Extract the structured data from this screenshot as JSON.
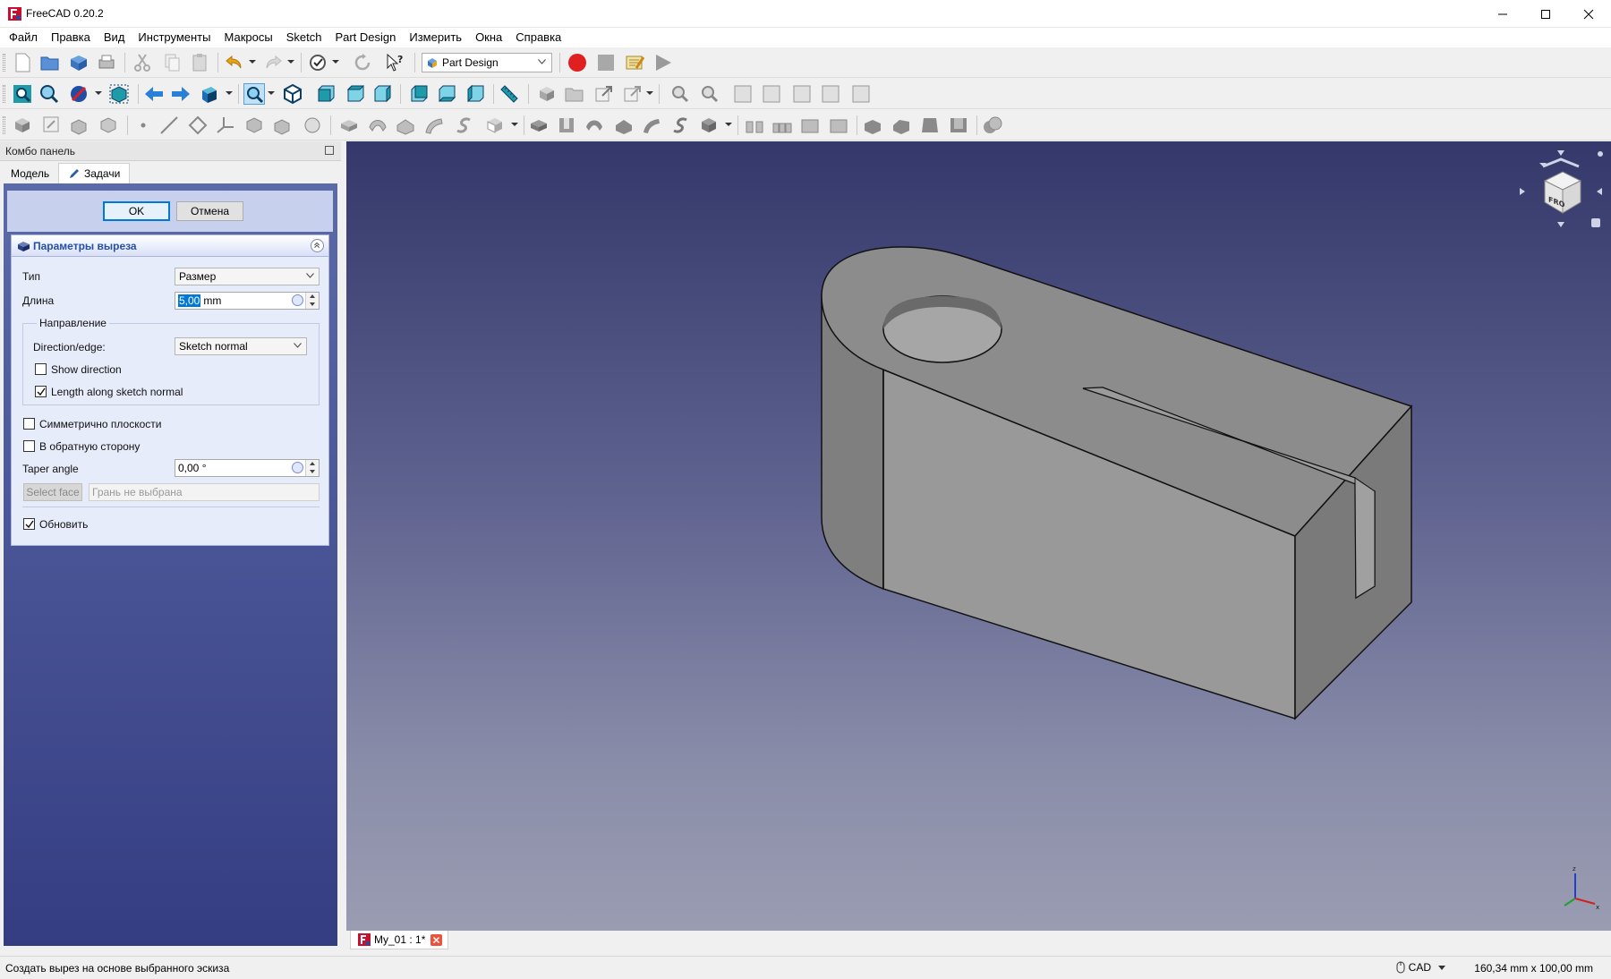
{
  "window": {
    "title": "FreeCAD 0.20.2"
  },
  "menu": [
    "Файл",
    "Правка",
    "Вид",
    "Инструменты",
    "Макросы",
    "Sketch",
    "Part Design",
    "Измерить",
    "Окна",
    "Справка"
  ],
  "toolbar": {
    "workbench": "Part Design"
  },
  "combo_panel": {
    "title": "Комбо панель",
    "tabs": {
      "model": "Модель",
      "tasks": "Задачи"
    },
    "ok_label": "OK",
    "cancel_label": "Отмена",
    "params": {
      "title": "Параметры выреза",
      "type_label": "Тип",
      "type_value": "Размер",
      "length_label": "Длина",
      "length_number": "5,00",
      "length_unit": "mm",
      "direction_group": "Направление",
      "direction_label": "Direction/edge:",
      "direction_value": "Sketch normal",
      "show_direction": "Show direction",
      "show_direction_checked": false,
      "length_along_normal": "Length along sketch normal",
      "length_along_normal_checked": true,
      "symmetric": "Симметрично плоскости",
      "symmetric_checked": false,
      "reversed": "В обратную сторону",
      "reversed_checked": false,
      "taper_label": "Taper angle",
      "taper_value": "0,00 °",
      "select_face": "Select face",
      "face_placeholder": "Грань не выбрана",
      "update": "Обновить",
      "update_checked": true
    }
  },
  "document_tab": {
    "label": "My_01 : 1*"
  },
  "statusbar": {
    "message": "Создать вырез на основе выбранного эскиза",
    "nav_style": "CAD",
    "dimensions": "160,34 mm x 100,00 mm"
  },
  "colors": {
    "accent": "#0078d7",
    "viewport_top": "#34386a",
    "viewport_bottom": "#9a9cb2",
    "record_button": "#e02020"
  }
}
